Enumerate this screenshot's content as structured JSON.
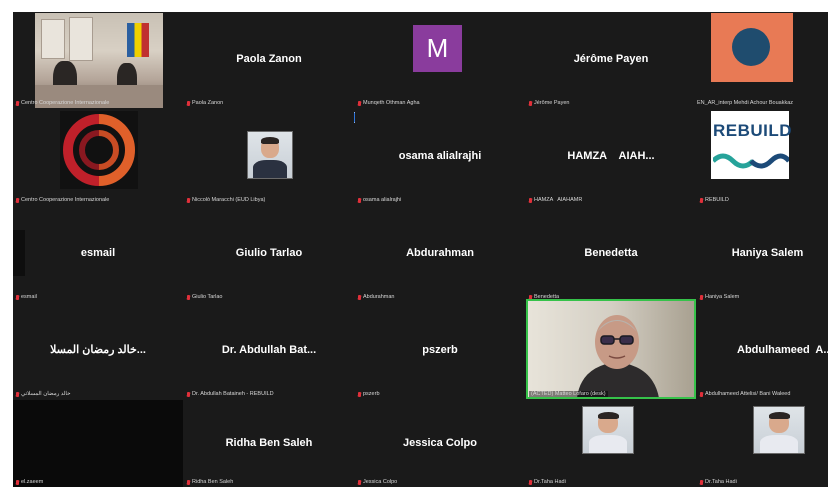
{
  "accent_color": "#36c24a",
  "muted_icon_color": "#e0303a",
  "tiles": [
    {
      "label": "Centro Cooperazione Internazionale",
      "display": "video",
      "content": "room-photo"
    },
    {
      "name": "Paola Zanon",
      "label": "Paola Zanon",
      "display": "name"
    },
    {
      "avatar_letter": "M",
      "label": "Munqeth Othman Agha",
      "display": "avatar"
    },
    {
      "name": "Jérôme Payen",
      "label": "Jérôme Payen",
      "display": "name"
    },
    {
      "label": "EN_AR_interp Mehdi Achour Bouakkaz",
      "display": "logo",
      "content": "orange-circle-logo"
    },
    {
      "label": "Centro Cooperazione Internazionale",
      "display": "logo",
      "content": "ring-logo"
    },
    {
      "label": "Niccolò Maracchi (EUD Libya)",
      "display": "photo"
    },
    {
      "name": "osama alialrajhi",
      "label": "osama alialrajhi",
      "display": "name"
    },
    {
      "name": "HAMZA    AIAH...",
      "label": "HAMZA   AIAHAMR",
      "display": "name"
    },
    {
      "logo_text": "REBUILD",
      "label": "REBUILD",
      "display": "logo",
      "content": "rebuild-logo"
    },
    {
      "name": "esmail",
      "label": "esmail",
      "display": "name"
    },
    {
      "name": "Giulio Tarlao",
      "label": "Giulio Tarlao",
      "display": "name"
    },
    {
      "name": "Abdurahman",
      "label": "Abdurahman",
      "display": "name"
    },
    {
      "name": "Benedetta",
      "label": "Benedetta",
      "display": "name"
    },
    {
      "name": "Haniya Salem",
      "label": "Haniya Salem",
      "display": "name"
    },
    {
      "name": "...خالد رمضان المسلا",
      "label": "خالد رمضان المسلاتي",
      "display": "name"
    },
    {
      "name": "Dr. Abdullah Bat...",
      "label": "Dr. Abdullah Bataineh - REBUILD",
      "display": "name"
    },
    {
      "name": "pszerb",
      "label": "pszerb",
      "display": "name"
    },
    {
      "label": "(ACTED) Matteo Lofaro (desk)",
      "display": "active-video",
      "content": "man-with-glasses"
    },
    {
      "name": "Abdulhameed  A...",
      "label": "Abdulhameed Attelisi/ Bani Waleed",
      "display": "name"
    },
    {
      "label": "el.zaeem",
      "display": "dark"
    },
    {
      "name": "Ridha Ben Saleh",
      "label": "Ridha Ben Saleh",
      "display": "name"
    },
    {
      "name": "Jessica Colpo",
      "label": "Jessica Colpo",
      "display": "name"
    },
    {
      "label": "Dr.Taha Hadi",
      "display": "photo"
    },
    {
      "label": "Dr.Taha Hadi",
      "display": "photo"
    }
  ]
}
